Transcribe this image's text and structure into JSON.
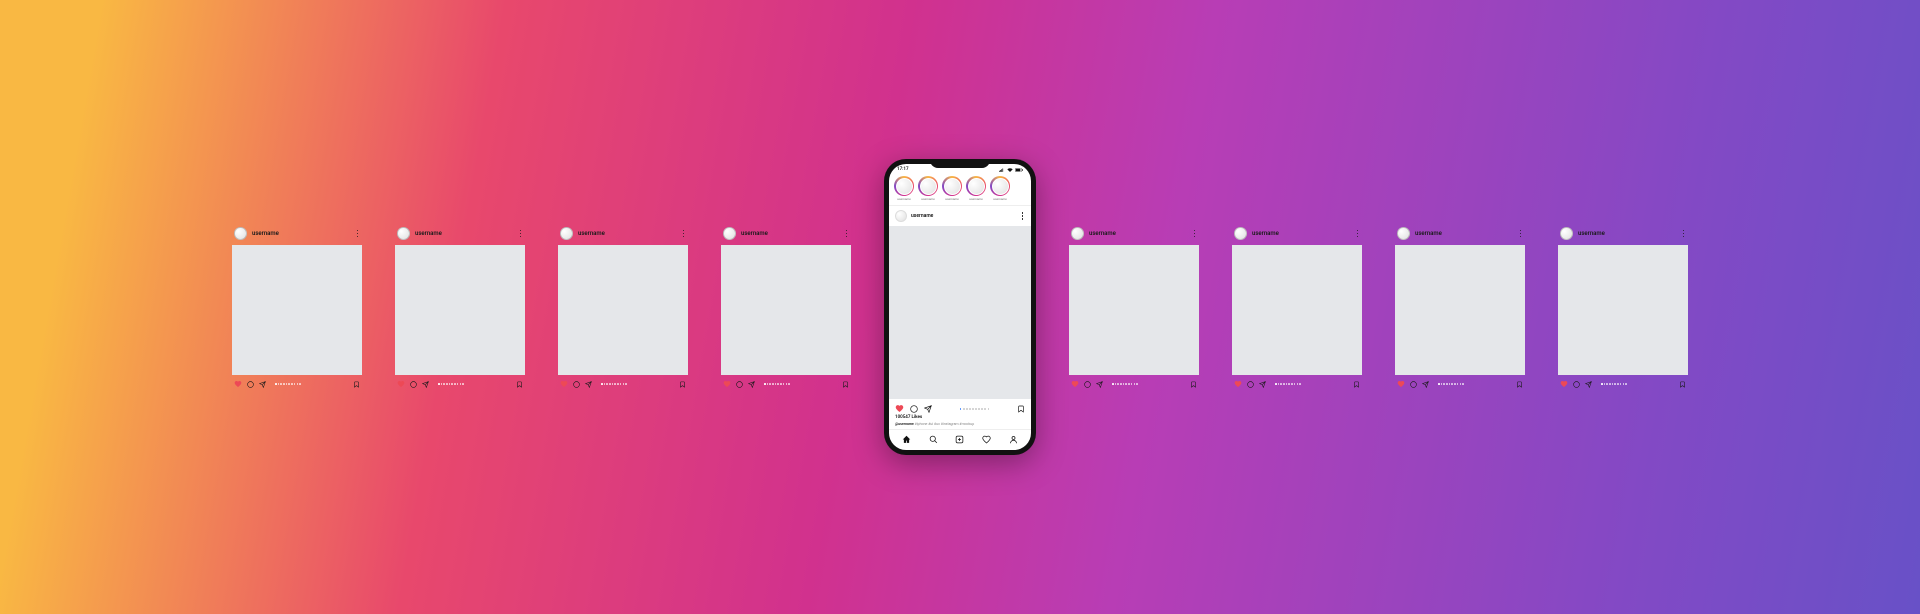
{
  "background_gradient": [
    "#f9b843",
    "#e8486c",
    "#d1318e",
    "#8349c5",
    "#6851c7"
  ],
  "posts": [
    {
      "username": "username"
    },
    {
      "username": "username"
    },
    {
      "username": "username"
    },
    {
      "username": "username"
    },
    {
      "username": "username"
    },
    {
      "username": "username"
    },
    {
      "username": "username"
    },
    {
      "username": "username"
    }
  ],
  "phone": {
    "status_time": "17:17",
    "stories": [
      {
        "label": "username"
      },
      {
        "label": "username"
      },
      {
        "label": "username"
      },
      {
        "label": "username"
      },
      {
        "label": "username"
      }
    ],
    "post": {
      "username": "username",
      "likes": "100547 Likes",
      "caption_user": "@username",
      "caption_text": "#iphone #ui #ux #instagram #mockup"
    },
    "icons": {
      "heart_color": "#ed4956"
    }
  }
}
